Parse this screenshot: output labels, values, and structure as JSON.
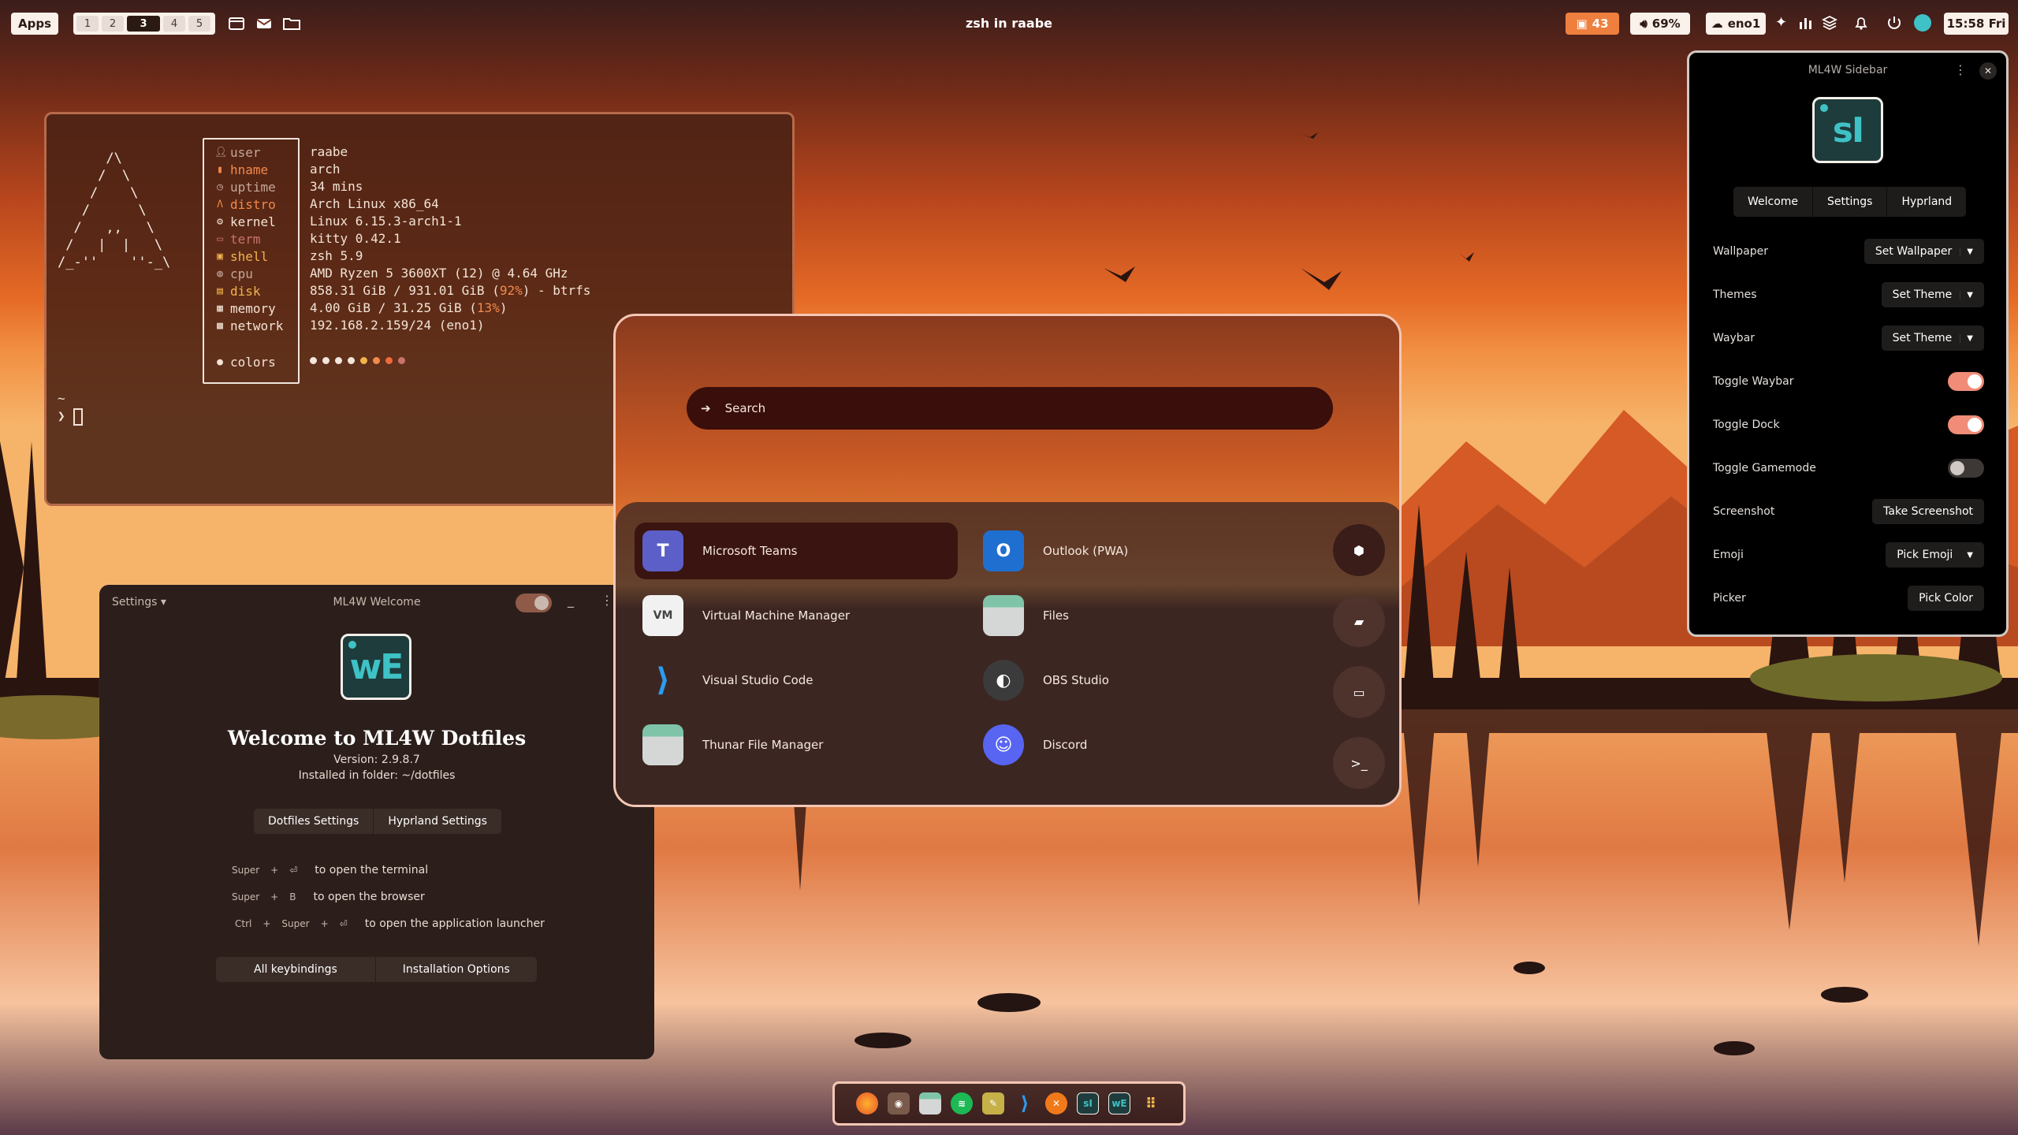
{
  "topbar": {
    "apps_label": "Apps",
    "workspaces": [
      "1",
      "2",
      "3",
      "4",
      "5"
    ],
    "active_workspace": "3",
    "window_title": "zsh in raabe",
    "updates": "43",
    "volume": "69%",
    "network": "eno1",
    "clock": "15:58 Fri"
  },
  "terminal": {
    "labels": [
      "user",
      "hname",
      "uptime",
      "distro",
      "kernel",
      "term",
      "shell",
      "cpu",
      "disk",
      "memory",
      "network",
      "colors"
    ],
    "values": {
      "user": "raabe",
      "hname": "arch",
      "uptime": "34 mins",
      "distro": "Arch Linux x86_64",
      "kernel": "Linux 6.15.3-arch1-1",
      "term": "kitty 0.42.1",
      "shell": "zsh 5.9",
      "cpu": "AMD Ryzen 5 3600XT (12) @ 4.64 GHz",
      "disk_a": "858.31 GiB / 931.01 GiB (",
      "disk_pct": "92%",
      "disk_b": ") - btrfs",
      "memory_a": "4.00 GiB / 31.25 GiB (",
      "memory_pct": "13%",
      "memory_b": ")",
      "network": "192.168.2.159/24 (eno1)"
    },
    "prompt_tilde": "~",
    "prompt_symbol": "❯",
    "colors": [
      "#f2e6dd",
      "#f2e6dd",
      "#f2e6dd",
      "#f2e6dd",
      "#f2b44b",
      "#f28a4b",
      "#ef6b3a",
      "#c9746b"
    ]
  },
  "welcome": {
    "settings_label": "Settings ▾",
    "window_title": "ML4W Welcome",
    "min_label": "_",
    "menu_label": "⋮",
    "logo_text": "wE",
    "heading": "Welcome to ML4W Dotfiles",
    "version": "Version: 2.9.8.7",
    "installed": "Installed in folder: ~/dotfiles",
    "btn_dotfiles": "Dotfiles Settings",
    "btn_hyprland": "Hyprland Settings",
    "kb1_keys": [
      "Super",
      "+",
      "⏎"
    ],
    "kb1_text": "to open the terminal",
    "kb2_keys": [
      "Super",
      "+",
      "B"
    ],
    "kb2_text": "to open the browser",
    "kb3_keys": [
      "Ctrl",
      "+",
      "Super",
      "+",
      "⏎"
    ],
    "kb3_text": "to open the application launcher",
    "btn_keybindings": "All keybindings",
    "btn_install": "Installation Options"
  },
  "launcher": {
    "search_placeholder": "Search",
    "apps": [
      "Microsoft Teams",
      "Outlook (PWA)",
      "Virtual Machine Manager",
      "Files",
      "Visual Studio Code",
      "OBS Studio",
      "Thunar File Manager",
      "Discord"
    ],
    "selected_app": "Microsoft Teams"
  },
  "sidebar": {
    "title": "ML4W Sidebar",
    "logo_text": "sI",
    "tabs": [
      "Welcome",
      "Settings",
      "Hyprland"
    ],
    "rows": {
      "wallpaper": {
        "label": "Wallpaper",
        "button": "Set Wallpaper"
      },
      "themes": {
        "label": "Themes",
        "button": "Set Theme"
      },
      "waybar": {
        "label": "Waybar",
        "button": "Set Theme"
      },
      "toggle_waybar": {
        "label": "Toggle Waybar",
        "on": true
      },
      "toggle_dock": {
        "label": "Toggle Dock",
        "on": true
      },
      "toggle_gamemode": {
        "label": "Toggle Gamemode",
        "on": false
      },
      "screenshot": {
        "label": "Screenshot",
        "button": "Take Screenshot"
      },
      "emoji": {
        "label": "Emoji",
        "button": "Pick Emoji"
      },
      "picker": {
        "label": "Picker",
        "button": "Pick Color"
      }
    }
  },
  "dock": {
    "icons": [
      "firefox-icon",
      "game-icon",
      "files-icon",
      "spotify-icon",
      "tools-icon",
      "vscode-icon",
      "close-circle-icon",
      "sidebar-icon",
      "welcome-icon",
      "apps-grid-icon"
    ]
  },
  "colors": {
    "accent": "#ef7f3e",
    "toggle_on": "#f08c78",
    "teal": "#3ec2c6"
  }
}
